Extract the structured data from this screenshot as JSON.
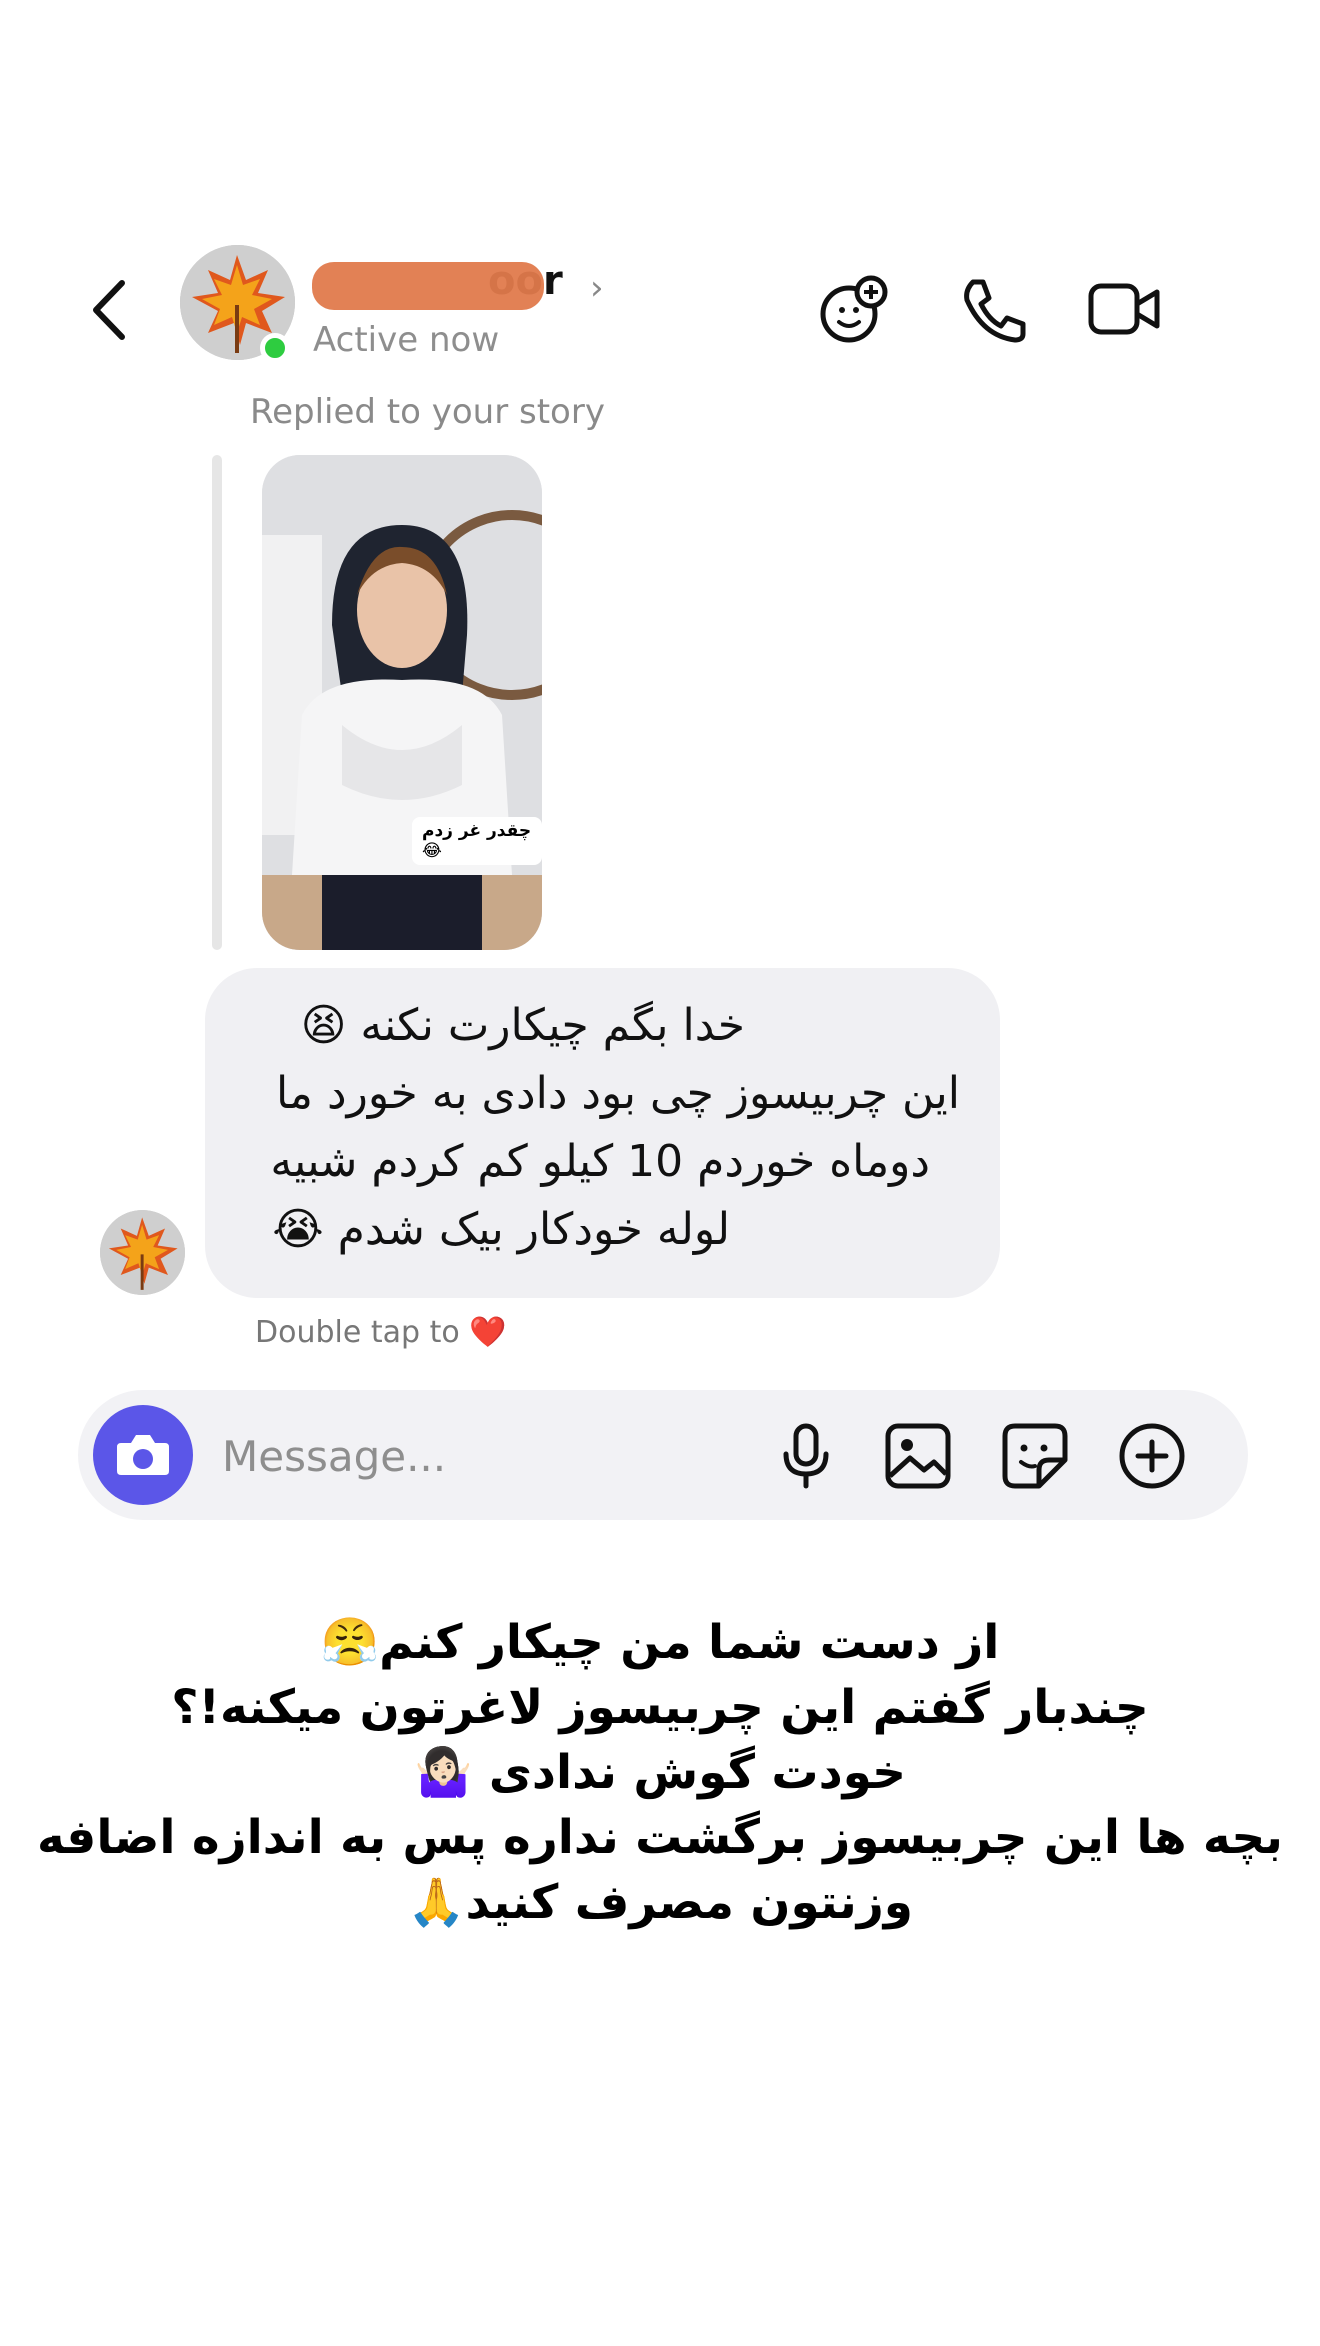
{
  "header": {
    "name_suffix": "oor",
    "chevron": "›",
    "status": "Active now",
    "back_icon": "chevron-left-icon",
    "icons": [
      "effects-icon",
      "phone-icon",
      "video-camera-icon"
    ],
    "online_color": "#2ecc40"
  },
  "reply": {
    "label": "Replied to your story",
    "sticker_text": "چقدر غر زدم😂"
  },
  "message": {
    "lines": [
      "خدا بگم چیکارت نکنه 😫",
      "این چربیسوز چی بود دادی به خورد ما",
      "دوماه خوردم 10 کیلو کم کردم شبیه",
      "لوله خودکار بیک شدم 😭"
    ],
    "double_tap_text": "Double tap to",
    "heart": "❤️"
  },
  "composer": {
    "placeholder": "Message...",
    "camera_color": "#5b56e8",
    "icons": [
      "microphone-icon",
      "gallery-icon",
      "sticker-icon",
      "add-icon"
    ]
  },
  "caption": {
    "lines": [
      "از دست شما من چیکار کنم😤",
      "چندبار گفتم این چربیسوز لاغرتون میکنه!؟",
      "خودت گوش ندادی 🤷🏻‍♀️",
      "بچه ها این چربیسوز برگشت نداره پس به اندازه اضافه",
      "وزنتون مصرف کنید🙏"
    ]
  }
}
